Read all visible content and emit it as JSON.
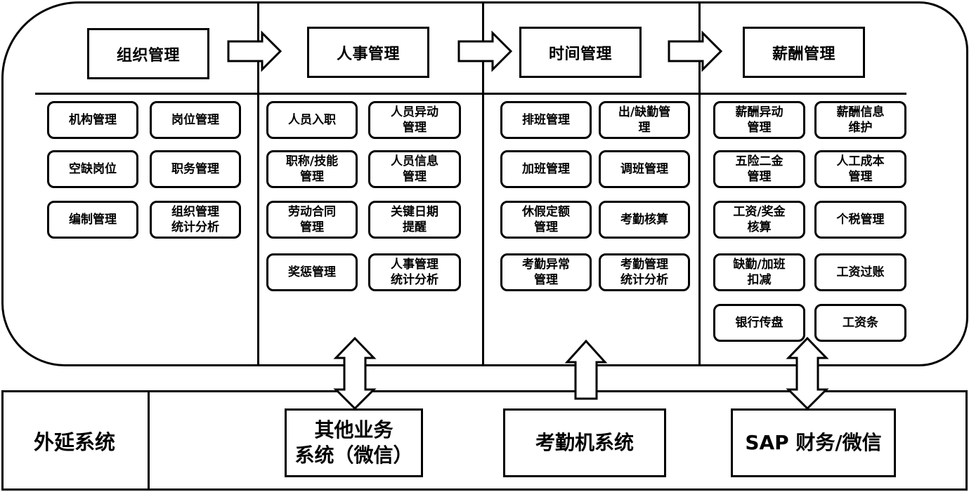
{
  "diagram": {
    "columns": [
      {
        "id": "org",
        "title": "组织管理",
        "modules": [
          [
            "机构管理",
            "岗位管理"
          ],
          [
            "空缺岗位",
            "职务管理"
          ],
          [
            "编制管理",
            "组织管理\n统计分析"
          ]
        ]
      },
      {
        "id": "hr",
        "title": "人事管理",
        "modules": [
          [
            "人员入职",
            "人员异动\n管理"
          ],
          [
            "职称/技能\n管理",
            "人员信息\n管理"
          ],
          [
            "劳动合同\n管理",
            "关键日期\n提醒"
          ],
          [
            "奖惩管理",
            "人事管理\n统计分析"
          ]
        ]
      },
      {
        "id": "time",
        "title": "时间管理",
        "modules": [
          [
            "排班管理",
            "出/缺勤管\n理"
          ],
          [
            "加班管理",
            "调班管理"
          ],
          [
            "休假定额\n管理",
            "考勤核算"
          ],
          [
            "考勤异常\n管理",
            "考勤管理\n统计分析"
          ]
        ]
      },
      {
        "id": "pay",
        "title": "薪酬管理",
        "modules": [
          [
            "薪酬异动\n管理",
            "薪酬信息\n维护"
          ],
          [
            "五险二金\n管理",
            "人工成本\n管理"
          ],
          [
            "工资/奖金\n核算",
            "个税管理"
          ],
          [
            "缺勤/加班\n扣减",
            "工资过账"
          ],
          [
            "银行传盘",
            "工资条"
          ]
        ]
      }
    ],
    "flow_arrows": [
      "right-arrow",
      "right-arrow",
      "right-arrow"
    ],
    "external": {
      "label": "外延系统",
      "systems": [
        {
          "name": "其他业务\n系统（微信）",
          "connects_to": "人事管理",
          "arrow": "bidirectional"
        },
        {
          "name": "考勤机系统",
          "connects_to": "时间管理",
          "arrow": "up"
        },
        {
          "name": "SAP 财务/微信",
          "connects_to": "薪酬管理",
          "arrow": "bidirectional"
        }
      ]
    }
  }
}
